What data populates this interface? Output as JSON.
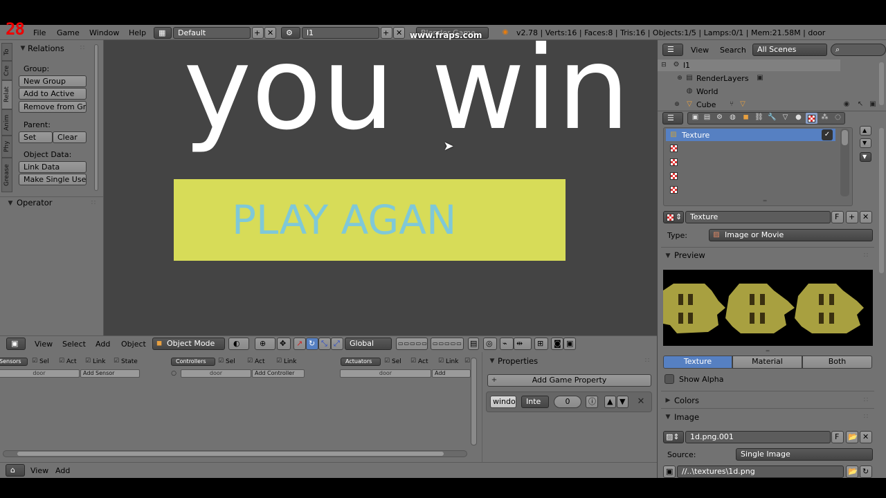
{
  "fraps": {
    "counter": "28",
    "watermark": "www.fraps.com"
  },
  "info_bar": {
    "menus": [
      "File",
      "Game",
      "Window",
      "Help"
    ],
    "layout": "Default",
    "scene": "l1",
    "engine": "Blender Game",
    "stats": "v2.78 | Verts:16 | Faces:8 | Tris:16 | Objects:1/5 | Lamps:0/1 | Mem:21.58M | door"
  },
  "tool_shelf": {
    "tabs": [
      "To",
      "Cre",
      "Relat",
      "Anim",
      "Phy",
      "Grease"
    ],
    "relations_title": "Relations",
    "group_label": "Group:",
    "new_group": "New Group",
    "add_to_active": "Add to Active",
    "remove_from_group": "Remove from Gr...",
    "parent_label": "Parent:",
    "set": "Set",
    "clear": "Clear",
    "object_data_label": "Object Data:",
    "link_data": "Link Data",
    "make_single_user": "Make Single User",
    "operator_title": "Operator"
  },
  "viewport": {
    "headline": "you win",
    "button_text": "PLAY AGAN",
    "colors": {
      "bg": "#444444",
      "button": "#d7dc58",
      "button_text": "#7fc8d8",
      "headline": "#ffffff"
    }
  },
  "view3d_header": {
    "menus": [
      "View",
      "Select",
      "Add",
      "Object"
    ],
    "mode": "Object Mode",
    "orientation": "Global"
  },
  "logic_editor": {
    "sensors": {
      "label": "Sensors",
      "sel": "Sel",
      "act": "Act",
      "link": "Link",
      "state": "State",
      "object": "door",
      "add": "Add Sensor"
    },
    "controllers": {
      "label": "Controllers",
      "sel": "Sel",
      "act": "Act",
      "link": "Link",
      "object": "door",
      "add": "Add Controller"
    },
    "actuators": {
      "label": "Actuators",
      "sel": "Sel",
      "act": "Act",
      "link": "Link",
      "object": "door",
      "add": "Add Actuator"
    },
    "properties_title": "Properties",
    "add_game_property": "Add Game Property",
    "prop_name": "windo",
    "prop_type": "Inte",
    "prop_value": "0"
  },
  "logic_header": {
    "menus": [
      "View",
      "Add"
    ]
  },
  "outliner": {
    "menus": [
      "View",
      "Search"
    ],
    "filter": "All Scenes",
    "items": [
      {
        "label": "l1"
      },
      {
        "label": "RenderLayers"
      },
      {
        "label": "World"
      },
      {
        "label": "Cube"
      }
    ]
  },
  "properties": {
    "texture_slot": "Texture",
    "texture_name": "Texture",
    "type_label": "Type:",
    "type_value": "Image or Movie",
    "preview_title": "Preview",
    "preview_tabs": [
      "Texture",
      "Material",
      "Both"
    ],
    "show_alpha": "Show Alpha",
    "colors_title": "Colors",
    "image_title": "Image",
    "image_name": "1d.png.001",
    "source_label": "Source:",
    "source_value": "Single Image",
    "file_path": "//..\\textures\\1d.png",
    "f_label": "F"
  }
}
